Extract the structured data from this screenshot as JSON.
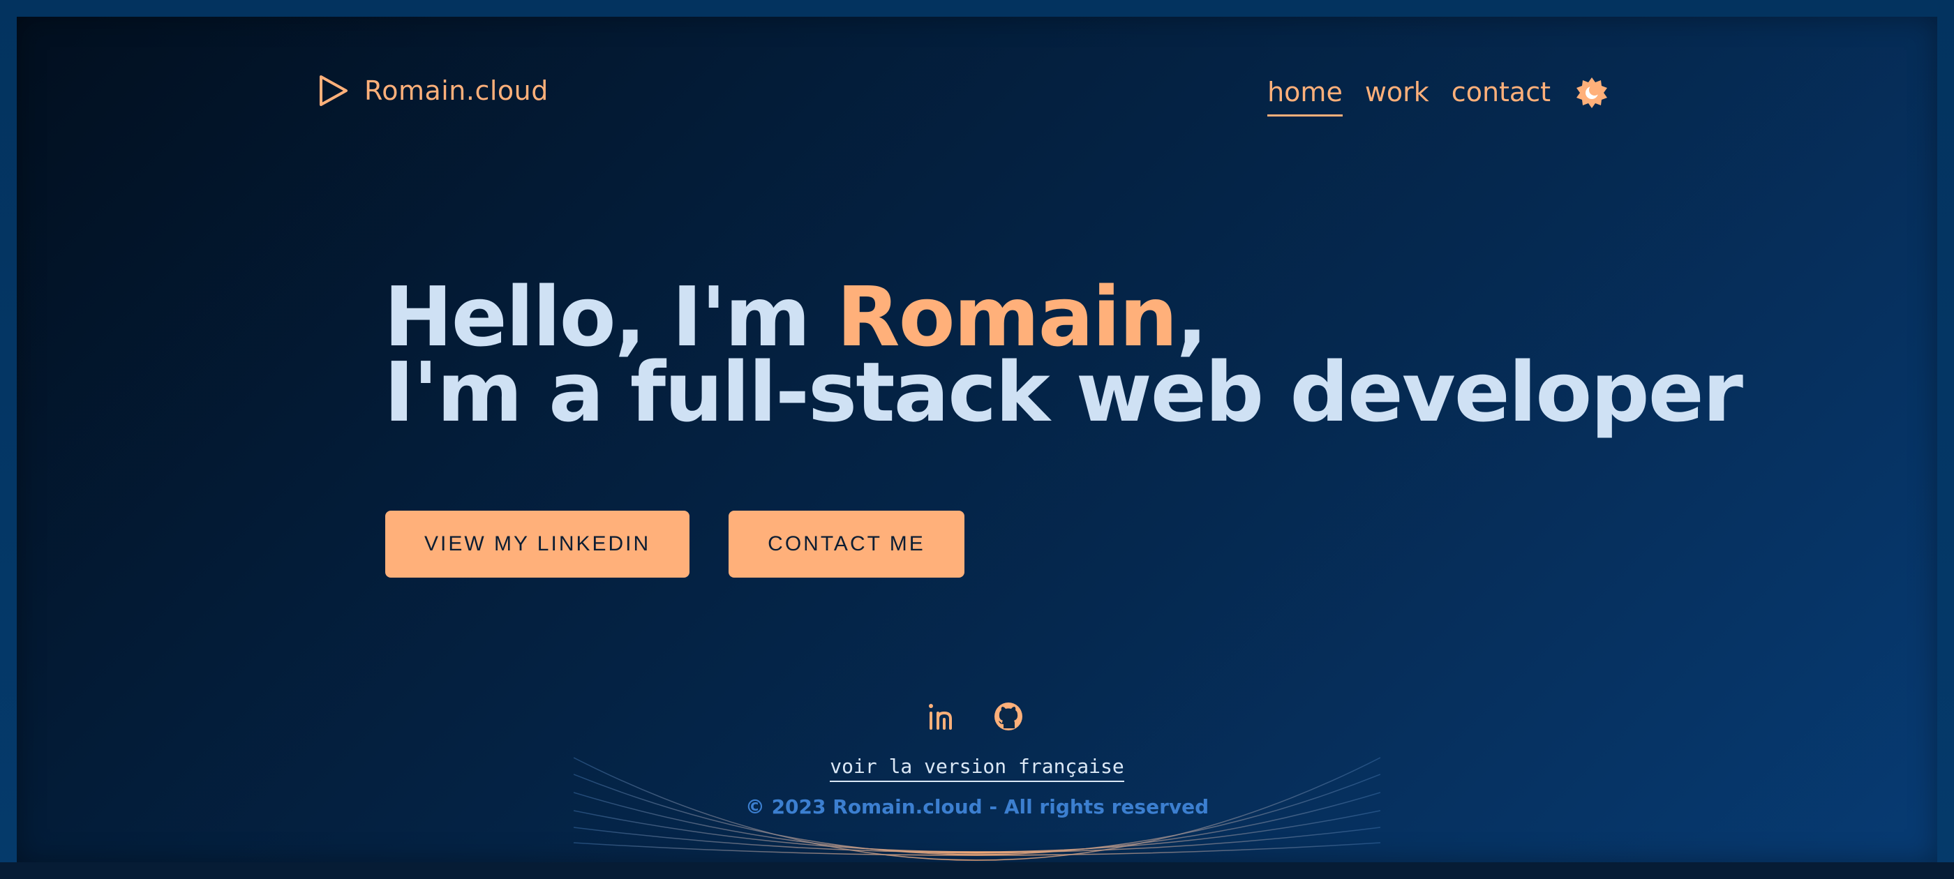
{
  "header": {
    "brand_name": "Romain.cloud",
    "nav": [
      {
        "label": "home",
        "active": true
      },
      {
        "label": "work",
        "active": false
      },
      {
        "label": "contact",
        "active": false
      }
    ],
    "theme_toggle_icon": "sun-icon"
  },
  "hero": {
    "line1_prefix": "Hello, I'm ",
    "line1_name": "Romain",
    "line1_suffix": ",",
    "line2": "I'm a full-stack web developer"
  },
  "actions": {
    "linkedin_label": "VIEW MY LINKEDIN",
    "contact_label": "CONTACT ME"
  },
  "footer": {
    "social_icons": [
      "linkedin-icon",
      "github-icon"
    ],
    "language_link": "voir la version française",
    "copyright": "© 2023 Romain.cloud - All rights reserved"
  },
  "colors": {
    "accent": "#ffb07a",
    "heading": "#cfe1f4",
    "background_dark": "#020f1f",
    "background_light": "#073b73",
    "copyright": "#3c7fd0"
  }
}
